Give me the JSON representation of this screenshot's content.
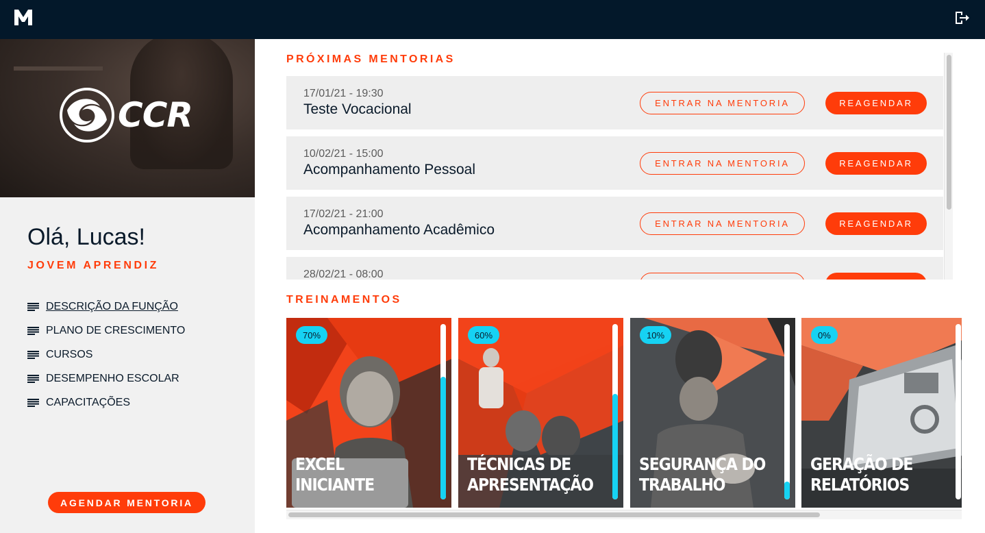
{
  "header": {
    "logo_icon": "m-logo-icon",
    "logout_icon": "logout-icon"
  },
  "sidebar": {
    "brand": "CCR",
    "greeting": "Olá, Lucas!",
    "role": "JOVEM APRENDIZ",
    "menu": [
      {
        "label": "DESCRIÇÃO DA FUNÇÃO",
        "active": true
      },
      {
        "label": "PLANO DE CRESCIMENTO",
        "active": false
      },
      {
        "label": "CURSOS",
        "active": false
      },
      {
        "label": "DESEMPENHO ESCOLAR",
        "active": false
      },
      {
        "label": "CAPACITAÇÕES",
        "active": false
      }
    ],
    "cta_label": "AGENDAR MENTORIA"
  },
  "mentorias": {
    "title": "PRÓXIMAS MENTORIAS",
    "enter_label": "ENTRAR NA MENTORIA",
    "reschedule_label": "REAGENDAR",
    "items": [
      {
        "date": "17/01/21 - 19:30",
        "name": "Teste Vocacional"
      },
      {
        "date": "10/02/21 - 15:00",
        "name": "Acompanhamento Pessoal"
      },
      {
        "date": "17/02/21 - 21:00",
        "name": "Acompanhamento Acadêmico"
      },
      {
        "date": "28/02/21 - 08:00",
        "name": ""
      }
    ]
  },
  "treinamentos": {
    "title": "TREINAMENTOS",
    "items": [
      {
        "pct_label": "70%",
        "progress": 0.7,
        "line1": "EXCEL",
        "line2": "INICIANTE"
      },
      {
        "pct_label": "60%",
        "progress": 0.6,
        "line1": "TÉCNICAS DE",
        "line2": "APRESENTAÇÃO"
      },
      {
        "pct_label": "10%",
        "progress": 0.1,
        "line1": "SEGURANÇA DO",
        "line2": "TRABALHO"
      },
      {
        "pct_label": "0%",
        "progress": 0.0,
        "line1": "GERAÇÃO DE",
        "line2": "RELATÓRIOS"
      }
    ]
  },
  "colors": {
    "accent": "#ff3c0a",
    "topbar": "#03182a",
    "progress": "#16d2f3"
  }
}
